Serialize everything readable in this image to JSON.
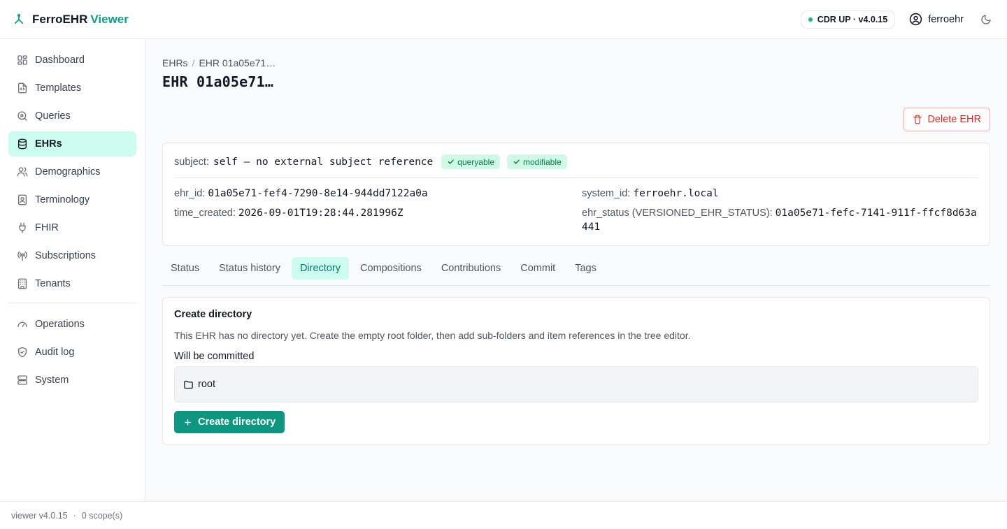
{
  "header": {
    "brand_name": "FerroEHR",
    "brand_accent": "Viewer",
    "status_text": "CDR UP · v4.0.15",
    "username": "ferroehr"
  },
  "sidebar": {
    "items": [
      {
        "label": "Dashboard",
        "icon": "dashboard-icon"
      },
      {
        "label": "Templates",
        "icon": "file-code-icon"
      },
      {
        "label": "Queries",
        "icon": "search-file-icon"
      },
      {
        "label": "EHRs",
        "icon": "database-icon",
        "active": true
      },
      {
        "label": "Demographics",
        "icon": "users-icon"
      },
      {
        "label": "Terminology",
        "icon": "book-icon"
      },
      {
        "label": "FHIR",
        "icon": "plug-icon"
      },
      {
        "label": "Subscriptions",
        "icon": "broadcast-icon"
      },
      {
        "label": "Tenants",
        "icon": "building-icon"
      }
    ],
    "secondary_items": [
      {
        "label": "Operations",
        "icon": "gauge-icon"
      },
      {
        "label": "Audit log",
        "icon": "shield-icon"
      },
      {
        "label": "System",
        "icon": "server-icon"
      }
    ]
  },
  "breadcrumb": {
    "root": "EHRs",
    "current": "EHR 01a05e71…"
  },
  "page_title": "EHR 01a05e71…",
  "actions": {
    "delete_label": "Delete EHR"
  },
  "ehr": {
    "subject_label": "subject:",
    "subject_value": "self — no external subject reference",
    "badges": [
      "queryable",
      "modifiable"
    ],
    "ehr_id_label": "ehr_id:",
    "ehr_id": "01a05e71-fef4-7290-8e14-944dd7122a0a",
    "system_id_label": "system_id:",
    "system_id": "ferroehr.local",
    "time_created_label": "time_created:",
    "time_created": "2026-09-01T19:28:44.281996Z",
    "ehr_status_label": "ehr_status (VERSIONED_EHR_STATUS):",
    "ehr_status": "01a05e71-fefc-7141-911f-ffcf8d63a441"
  },
  "tabs": [
    "Status",
    "Status history",
    "Directory",
    "Compositions",
    "Contributions",
    "Commit",
    "Tags"
  ],
  "active_tab": "Directory",
  "directory": {
    "title": "Create directory",
    "description": "This EHR has no directory yet. Create the empty root folder, then add sub-folders and item references in the tree editor.",
    "commit_label": "Will be committed",
    "root_name": "root",
    "create_label": "Create directory"
  },
  "footer": {
    "version": "viewer v4.0.15",
    "sep": "·",
    "scopes": "0 scope(s)"
  }
}
